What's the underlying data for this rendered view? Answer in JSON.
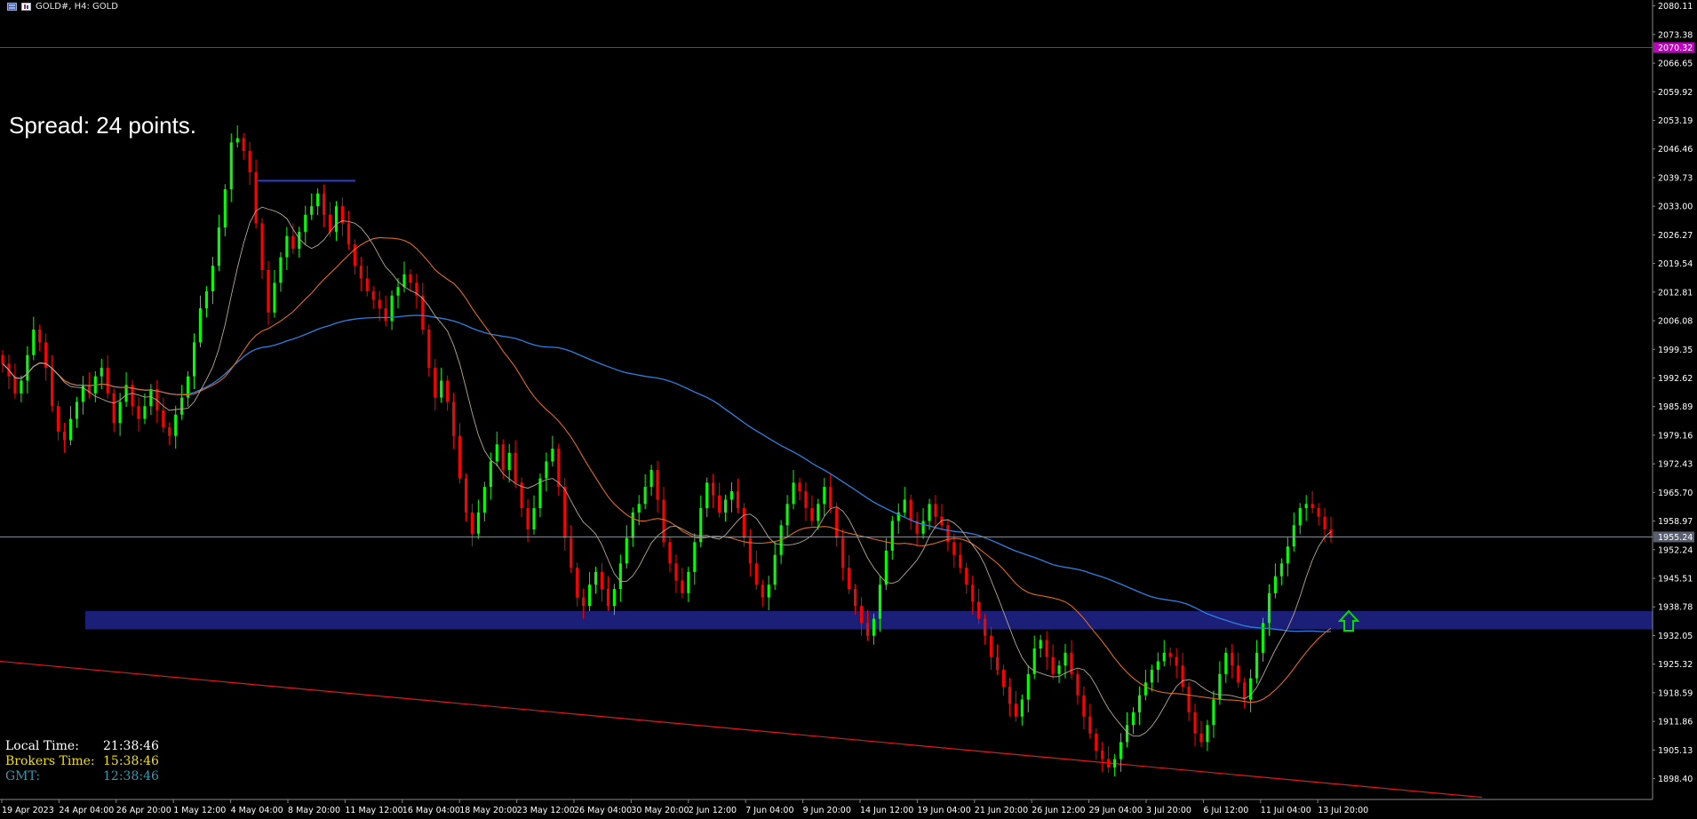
{
  "header": {
    "title": "GOLD#, H4:  GOLD"
  },
  "spread_text": "Spread: 24 points.",
  "clocks": [
    {
      "label": "Local Time:",
      "value": "21:38:46",
      "color": "#ffffff"
    },
    {
      "label": "Brokers Time:",
      "value": "15:38:46",
      "color": "#f0e000"
    },
    {
      "label": "GMT:",
      "value": "12:38:46",
      "color": "#2e9bb0"
    }
  ],
  "colors": {
    "background": "#000000",
    "bull": "#00ff00",
    "bear": "#ff0000",
    "ma_fast": "#b8a890",
    "ma_slow": "#e06a20",
    "ma_long": "#2f7fe0",
    "zone": "#1c1f78",
    "price_line": "#c000c0",
    "trend_line": "#e01a1a",
    "arrow": "#00e000"
  },
  "chart_data": {
    "type": "candlestick",
    "symbol": "GOLD#",
    "timeframe": "H4",
    "ylim": [
      1893.5,
      2081.5
    ],
    "y_ticks": [
      "2080.11",
      "2073.38",
      "2066.65",
      "2059.92",
      "2053.19",
      "2046.46",
      "2039.73",
      "2033.00",
      "2026.27",
      "2019.54",
      "2012.81",
      "2006.08",
      "1999.35",
      "1992.62",
      "1985.89",
      "1979.16",
      "1972.43",
      "1965.70",
      "1958.97",
      "1952.24",
      "1945.51",
      "1938.78",
      "1932.05",
      "1925.32",
      "1918.59",
      "1911.86",
      "1905.13",
      "1898.40"
    ],
    "x_labels": [
      "19 Apr 2023",
      "24 Apr 04:00",
      "26 Apr 20:00",
      "1 May 12:00",
      "4 May 04:00",
      "8 May 20:00",
      "11 May 12:00",
      "16 May 04:00",
      "18 May 20:00",
      "23 May 12:00",
      "26 May 04:00",
      "30 May 20:00",
      "2 Jun 12:00",
      "7 Jun 04:00",
      "9 Jun 20:00",
      "14 Jun 12:00",
      "19 Jun 04:00",
      "21 Jun 20:00",
      "26 Jun 12:00",
      "29 Jun 04:00",
      "3 Jul 20:00",
      "6 Jul 12:00",
      "11 Jul 04:00",
      "13 Jul 20:00"
    ],
    "current_price": "1955.24",
    "alert_price": "2070.32",
    "closes": [
      1996,
      1993,
      1989,
      1992,
      1998,
      2004,
      2001,
      1995,
      1986,
      1980,
      1978,
      1983,
      1987,
      1991,
      1989,
      1993,
      1995,
      1989,
      1982,
      1987,
      1991,
      1986,
      1983,
      1986,
      1990,
      1985,
      1981,
      1979,
      1984,
      1988,
      1993,
      2001,
      2009,
      2013,
      2019,
      2028,
      2037,
      2048,
      2049,
      2046,
      2041,
      2029,
      2018,
      2008,
      2015,
      2021,
      2026,
      2023,
      2027,
      2031,
      2033,
      2036,
      2031,
      2027,
      2033,
      2029,
      2024,
      2019,
      2016,
      2013,
      2011,
      2009,
      2006,
      2012,
      2014,
      2017,
      2015,
      2012,
      2004,
      1995,
      1988,
      1992,
      1987,
      1979,
      1969,
      1961,
      1956,
      1961,
      1967,
      1973,
      1977,
      1971,
      1975,
      1968,
      1962,
      1957,
      1962,
      1969,
      1973,
      1976,
      1967,
      1955,
      1948,
      1941,
      1939,
      1944,
      1947,
      1943,
      1939,
      1943,
      1949,
      1955,
      1961,
      1963,
      1967,
      1971,
      1964,
      1954,
      1949,
      1945,
      1942,
      1947,
      1954,
      1962,
      1968,
      1965,
      1961,
      1964,
      1966,
      1962,
      1955,
      1949,
      1944,
      1941,
      1944,
      1951,
      1958,
      1963,
      1968,
      1966,
      1962,
      1959,
      1963,
      1967,
      1962,
      1955,
      1948,
      1943,
      1939,
      1935,
      1932,
      1936,
      1944,
      1952,
      1959,
      1961,
      1964,
      1959,
      1956,
      1959,
      1963,
      1960,
      1958,
      1954,
      1951,
      1948,
      1944,
      1940,
      1936,
      1932,
      1927,
      1924,
      1920,
      1916,
      1913,
      1917,
      1923,
      1929,
      1931,
      1927,
      1923,
      1925,
      1928,
      1923,
      1918,
      1913,
      1909,
      1905,
      1903,
      1901,
      1903,
      1907,
      1911,
      1914,
      1918,
      1921,
      1924,
      1926,
      1928,
      1927,
      1925,
      1920,
      1914,
      1909,
      1907,
      1911,
      1917,
      1923,
      1928,
      1925,
      1921,
      1917,
      1922,
      1928,
      1935,
      1942,
      1946,
      1949,
      1953,
      1958,
      1962,
      1963,
      1962,
      1960,
      1957,
      1955
    ],
    "ma_fast": {
      "period": 10
    },
    "ma_slow": {
      "period": 30
    },
    "ma_long": {
      "period": 80
    },
    "zone": {
      "low": 1933.5,
      "high": 1937.8
    },
    "resistance_segment": {
      "price": 2039.0
    },
    "trend_line": {
      "start_price": 1926.0,
      "end_price": 1894.0
    }
  }
}
